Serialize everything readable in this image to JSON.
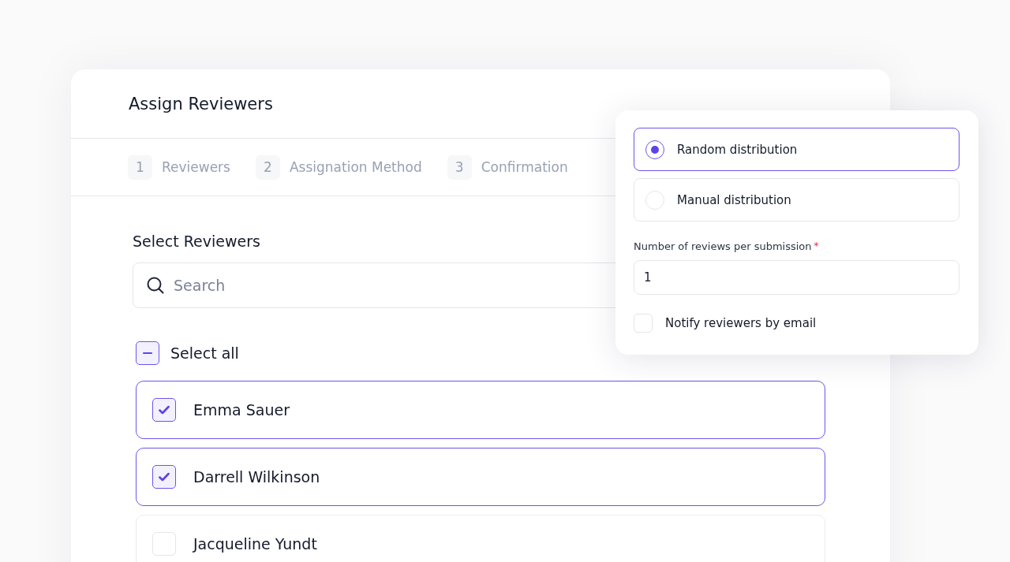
{
  "dialog": {
    "title": "Assign Reviewers"
  },
  "steps": [
    {
      "number": "1",
      "label": "Reviewers"
    },
    {
      "number": "2",
      "label": "Assignation Method"
    },
    {
      "number": "3",
      "label": "Confirmation"
    }
  ],
  "section_title": "Select Reviewers",
  "search": {
    "placeholder": "Search"
  },
  "select_all": {
    "label": "Select all",
    "indeterminate": true
  },
  "reviewers": [
    {
      "name": "Emma Sauer",
      "checked": true
    },
    {
      "name": "Darrell Wilkinson",
      "checked": true
    },
    {
      "name": "Jacqueline Yundt",
      "checked": false
    }
  ],
  "distribution_options": [
    {
      "label": "Random distribution",
      "selected": true
    },
    {
      "label": "Manual distribution",
      "selected": false
    }
  ],
  "reviews_field": {
    "label": "Number of reviews per submission",
    "required_mark": "*",
    "value": "1"
  },
  "notify": {
    "label": "Notify reviewers by email",
    "checked": false
  }
}
